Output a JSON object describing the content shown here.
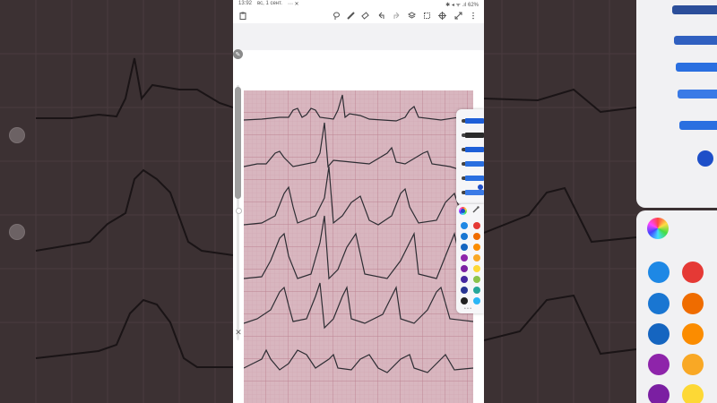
{
  "status_bar": {
    "time": "13:92",
    "date": "вс, 1 сент.",
    "notification_icons": "⋯ ✕",
    "battery_text": "✱ ◂ ᯤ .ıl 62%"
  },
  "toolbar": {
    "icons": [
      "clipboard-icon",
      "lasso-icon",
      "pencil-icon",
      "eraser-icon",
      "undo-icon",
      "redo-icon",
      "layers-icon",
      "crop-icon",
      "move-icon",
      "expand-icon",
      "more-icon"
    ]
  },
  "colors": {
    "ecg_paper": "#d8b6bf",
    "grid": "#c38f9c",
    "trace": "#2d2d33",
    "accent": "#1e4fc8"
  },
  "pen_panel": {
    "pens": [
      {
        "name": "pencil",
        "color": "#1e5fd8"
      },
      {
        "name": "fountain-pen",
        "color": "#2a2a2a"
      },
      {
        "name": "ballpoint-pen",
        "color": "#1e5fd8"
      },
      {
        "name": "brush",
        "color": "#2a6fe0"
      },
      {
        "name": "marker",
        "color": "#2a6fe0"
      },
      {
        "name": "highlighter",
        "color": "#3a7ae6"
      }
    ]
  },
  "color_panel": {
    "selected": "#1e4fc8",
    "swatches": [
      [
        "#1e88e5",
        "#e53935"
      ],
      [
        "#1976d2",
        "#ef6c00"
      ],
      [
        "#1565c0",
        "#fb8c00"
      ],
      [
        "#8e24aa",
        "#f9a825"
      ],
      [
        "#7b1fa2",
        "#fdd835"
      ],
      [
        "#4527a0",
        "#8bc34a"
      ],
      [
        "#283593",
        "#26a69a"
      ],
      [
        "#212121",
        "#29b6f6"
      ]
    ],
    "pager": "• • •"
  }
}
